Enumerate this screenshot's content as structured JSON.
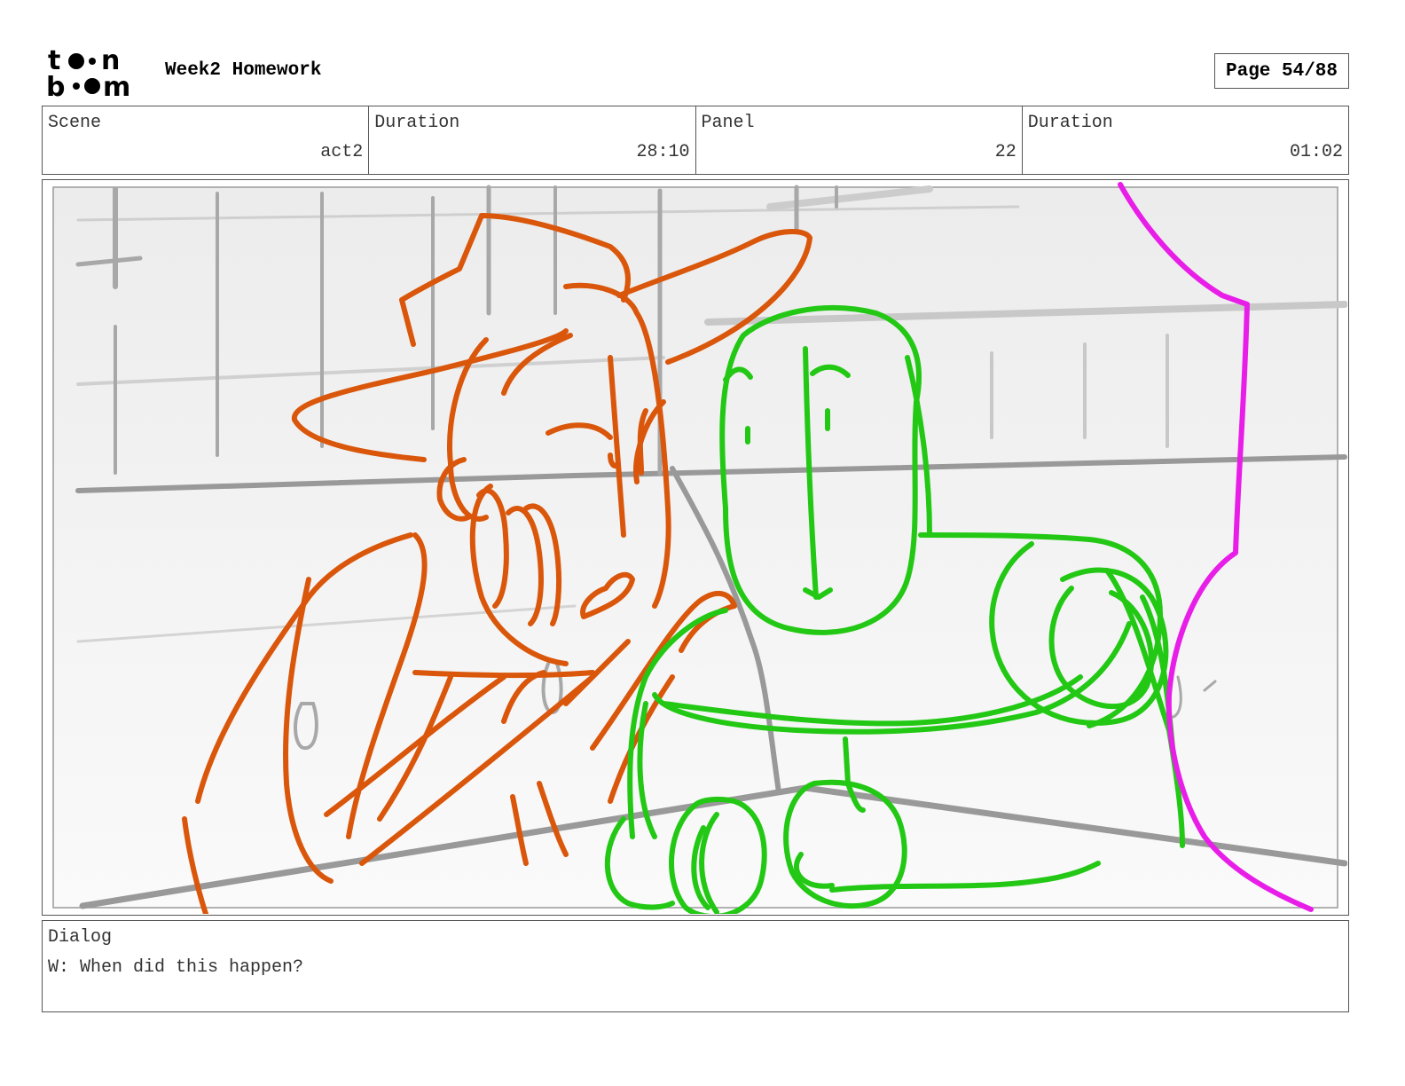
{
  "header": {
    "title": "Week2 Homework",
    "page": "Page 54/88",
    "logo_text": "toon boom"
  },
  "info": {
    "scene_label": "Scene",
    "scene_value": "act2",
    "duration_label": "Duration",
    "duration_value": "28:10",
    "panel_label": "Panel",
    "panel_value": "22",
    "panel_duration_label": "Duration",
    "panel_duration_value": "01:02"
  },
  "dialog": {
    "label": "Dialog",
    "text": "W: When did this happen?"
  },
  "colors": {
    "orange_character": "#d9560a",
    "green_character": "#22c814",
    "magenta_edge": "#e81ee8",
    "background_lines": "#a0a0a0"
  }
}
